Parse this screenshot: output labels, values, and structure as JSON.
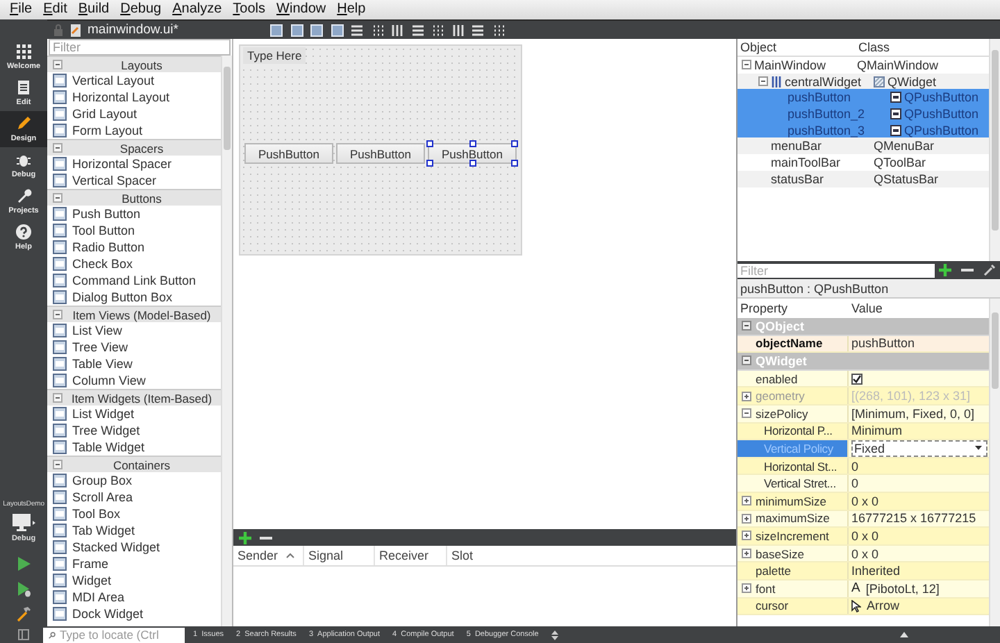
{
  "menu": [
    "File",
    "Edit",
    "Build",
    "Debug",
    "Analyze",
    "Tools",
    "Window",
    "Help"
  ],
  "document": {
    "title": "mainwindow.ui*"
  },
  "modes": [
    {
      "label": "Welcome",
      "kind": "welcome",
      "selected": false
    },
    {
      "label": "Edit",
      "kind": "edit",
      "selected": false
    },
    {
      "label": "Design",
      "kind": "design",
      "selected": true
    },
    {
      "label": "Debug",
      "kind": "debug",
      "selected": false
    },
    {
      "label": "Projects",
      "kind": "projects",
      "selected": false
    },
    {
      "label": "Help",
      "kind": "help",
      "selected": false
    }
  ],
  "kit": {
    "project": "LayoutsDemo",
    "config": "Debug"
  },
  "widget_box": {
    "filter_placeholder": "Filter",
    "sections": [
      {
        "title": "Layouts",
        "expanded": true,
        "items": [
          "Vertical Layout",
          "Horizontal Layout",
          "Grid Layout",
          "Form Layout"
        ]
      },
      {
        "title": "Spacers",
        "expanded": true,
        "items": [
          "Horizontal Spacer",
          "Vertical Spacer"
        ]
      },
      {
        "title": "Buttons",
        "expanded": true,
        "items": [
          "Push Button",
          "Tool Button",
          "Radio Button",
          "Check Box",
          "Command Link Button",
          "Dialog Button Box"
        ]
      },
      {
        "title": "Item Views (Model-Based)",
        "expanded": true,
        "items": [
          "List View",
          "Tree View",
          "Table View",
          "Column View"
        ]
      },
      {
        "title": "Item Widgets (Item-Based)",
        "expanded": true,
        "items": [
          "List Widget",
          "Tree Widget",
          "Table Widget"
        ]
      },
      {
        "title": "Containers",
        "expanded": true,
        "items": [
          "Group Box",
          "Scroll Area",
          "Tool Box",
          "Tab Widget",
          "Stacked Widget",
          "Frame",
          "Widget",
          "MDI Area",
          "Dock Widget"
        ]
      }
    ]
  },
  "form": {
    "menu_placeholder": "Type Here",
    "buttons": [
      {
        "label": "PushButton",
        "selected": false
      },
      {
        "label": "PushButton",
        "selected": false
      },
      {
        "label": "PushButton",
        "selected": true
      }
    ]
  },
  "object_inspector": {
    "columns": [
      "Object",
      "Class"
    ],
    "rows": [
      {
        "name": "MainWindow",
        "class": "QMainWindow",
        "selected": false,
        "expanded": true,
        "children": [
          {
            "name": "centralWidget",
            "class": "QWidget",
            "kind": "container",
            "selected": false,
            "expanded": true,
            "children": [
              {
                "name": "pushButton",
                "class": "QPushButton",
                "kind": "button",
                "selected": true
              },
              {
                "name": "pushButton_2",
                "class": "QPushButton",
                "kind": "button",
                "selected": true
              },
              {
                "name": "pushButton_3",
                "class": "QPushButton",
                "kind": "button",
                "selected": true
              }
            ]
          },
          {
            "name": "menuBar",
            "class": "QMenuBar",
            "kind": "plain",
            "selected": false
          },
          {
            "name": "mainToolBar",
            "class": "QToolBar",
            "kind": "plain",
            "selected": false
          },
          {
            "name": "statusBar",
            "class": "QStatusBar",
            "kind": "plain",
            "selected": false
          }
        ]
      }
    ],
    "filter_placeholder": "Filter"
  },
  "property_editor": {
    "object_label": "pushButton : QPushButton",
    "columns": [
      "Property",
      "Value"
    ],
    "groups": [
      {
        "name": "QObject",
        "expanded": true,
        "properties": [
          {
            "name": "objectName",
            "kind": "text",
            "value": "pushButton",
            "modified": true
          }
        ]
      },
      {
        "name": "QWidget",
        "expanded": true,
        "properties": [
          {
            "name": "enabled",
            "kind": "checkbox",
            "checked": true,
            "disabled": false
          },
          {
            "name": "geometry",
            "kind": "text",
            "value": "[(268, 101), 123 x 31]",
            "expanded": false,
            "disabled": true
          },
          {
            "name": "sizePolicy",
            "kind": "text",
            "value": "[Minimum, Fixed, 0, 0]",
            "expanded": true,
            "disabled": false,
            "children": [
              {
                "name": "Horizontal P...",
                "kind": "text",
                "value": "Minimum",
                "selected": false
              },
              {
                "name": "Vertical Policy",
                "kind": "combo",
                "value": "Fixed",
                "selected": true
              },
              {
                "name": "Horizontal St...",
                "kind": "text",
                "value": "0",
                "selected": false
              },
              {
                "name": "Vertical Stret...",
                "kind": "text",
                "value": "0",
                "selected": false
              }
            ]
          },
          {
            "name": "minimumSize",
            "kind": "text",
            "value": "0 x 0",
            "expanded": false,
            "disabled": false
          },
          {
            "name": "maximumSize",
            "kind": "text",
            "value": "16777215 x 16777215",
            "expanded": false,
            "disabled": false
          },
          {
            "name": "sizeIncrement",
            "kind": "text",
            "value": "0 x 0",
            "expanded": false,
            "disabled": false
          },
          {
            "name": "baseSize",
            "kind": "text",
            "value": "0 x 0",
            "expanded": false,
            "disabled": false
          },
          {
            "name": "palette",
            "kind": "text",
            "value": "Inherited",
            "disabled": false
          },
          {
            "name": "font",
            "kind": "font",
            "icon_text": "A",
            "value": "[PibotoLt, 12]",
            "expanded": false,
            "disabled": false
          },
          {
            "name": "cursor",
            "kind": "cursor",
            "value": "Arrow",
            "disabled": false
          }
        ]
      }
    ]
  },
  "signal_slot_editor": {
    "columns": [
      {
        "label": "Sender",
        "sorted": true
      },
      {
        "label": "Signal",
        "sorted": false
      },
      {
        "label": "Receiver",
        "sorted": false
      },
      {
        "label": "Slot",
        "sorted": false
      }
    ]
  },
  "locator": {
    "placeholder": "Type to locate (Ctrl"
  },
  "output_tabs": [
    {
      "number": "1",
      "label": "Issues"
    },
    {
      "number": "2",
      "label": "Search Results"
    },
    {
      "number": "3",
      "label": "Application Output"
    },
    {
      "number": "4",
      "label": "Compile Output"
    },
    {
      "number": "5",
      "label": "Debugger Console"
    }
  ]
}
